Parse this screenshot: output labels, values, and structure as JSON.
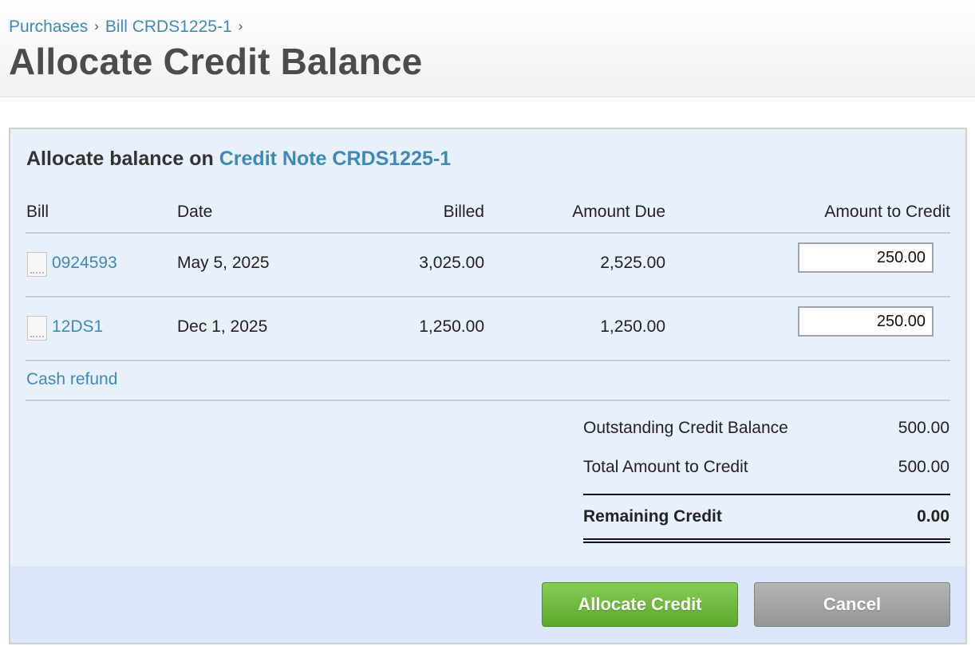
{
  "breadcrumb": {
    "items": [
      "Purchases",
      "Bill CRDS1225-1"
    ],
    "separator": "›"
  },
  "page": {
    "title": "Allocate Credit Balance"
  },
  "panel": {
    "heading_prefix": "Allocate balance on",
    "heading_link": "Credit Note CRDS1225-1"
  },
  "table": {
    "columns": [
      "Bill",
      "Date",
      "Billed",
      "Amount Due",
      "Amount to Credit"
    ],
    "rows": [
      {
        "bill": "0924593",
        "date": "May 5, 2025",
        "billed": "3,025.00",
        "amount_due": "2,525.00",
        "amount_to_credit": "250.00"
      },
      {
        "bill": "12DS1",
        "date": "Dec 1, 2025",
        "billed": "1,250.00",
        "amount_due": "1,250.00",
        "amount_to_credit": "250.00"
      }
    ]
  },
  "cash_refund_label": "Cash refund",
  "summary": {
    "outstanding_label": "Outstanding Credit Balance",
    "outstanding_value": "500.00",
    "total_label": "Total Amount to Credit",
    "total_value": "500.00",
    "remaining_label": "Remaining Credit",
    "remaining_value": "0.00"
  },
  "buttons": {
    "allocate_label": "Allocate Credit",
    "cancel_label": "Cancel"
  },
  "colors": {
    "link": "#3d8ab8",
    "panel_bg": "#e8f0fc",
    "footer_bg": "#dbe7fb",
    "primary_button": "#6cb83f",
    "cancel_button": "#a3a3a3"
  },
  "icons": {
    "bill_row": "document-icon",
    "breadcrumb_separator": "chevron-right-icon"
  }
}
